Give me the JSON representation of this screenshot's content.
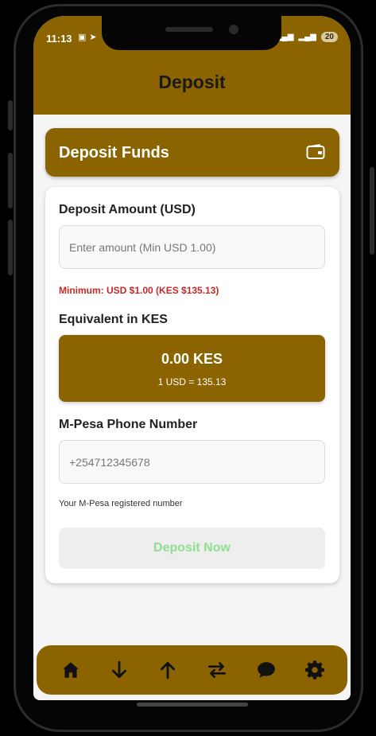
{
  "status_bar": {
    "time": "11:13",
    "battery": "20"
  },
  "header": {
    "title": "Deposit"
  },
  "funds_bar": {
    "title": "Deposit Funds",
    "icon": "wallet-icon"
  },
  "form": {
    "amount_label": "Deposit Amount (USD)",
    "amount_placeholder": "Enter amount (Min USD 1.00)",
    "amount_value": "",
    "minimum_note": "Minimum: USD $1.00 (KES $135.13)",
    "equivalent_label": "Equivalent in KES",
    "kes_amount": "0.00 KES",
    "exchange_rate": "1 USD = 135.13",
    "phone_label": "M-Pesa Phone Number",
    "phone_placeholder": "+254712345678",
    "phone_value": "",
    "phone_help": "Your M-Pesa registered number",
    "submit_label": "Deposit Now"
  },
  "bottom_nav": {
    "items": [
      {
        "icon": "home-icon"
      },
      {
        "icon": "arrow-down-icon"
      },
      {
        "icon": "arrow-up-icon"
      },
      {
        "icon": "transfer-icon"
      },
      {
        "icon": "chat-icon"
      },
      {
        "icon": "gear-icon"
      }
    ]
  },
  "colors": {
    "primary": "#8B6400",
    "error": "#c62828",
    "button_text_disabled": "#8ee08e"
  }
}
